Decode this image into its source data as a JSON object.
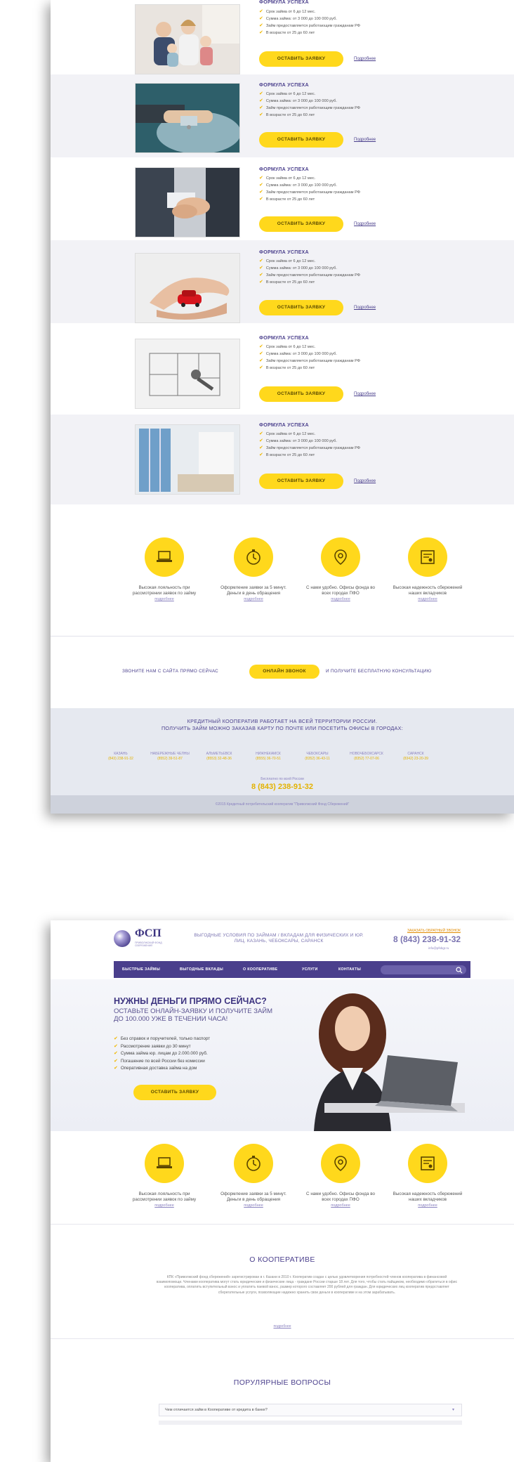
{
  "offers": {
    "title": "ФОРМУЛА УСПЕХА",
    "button": "ОСТАВИТЬ ЗАЯВКУ",
    "more": "Подробнее",
    "items": [
      {
        "image": "family-photo",
        "bullets": [
          "Срок займа от 6 до 12 мес.",
          "Сумма займа: от 3 000 до 100 000 руб.",
          "Займ предоставляется работающим гражданам РФ",
          "В возрасте от 25 до 60 лет"
        ]
      },
      {
        "image": "car-keys-photo",
        "bullets": [
          "Срок займа от 6 до 12 мес.",
          "Сумма займа: от 3 000 до 100 000 руб.",
          "Займ предоставляется работающим гражданам РФ",
          "В возрасте от 25 до 60 лет"
        ]
      },
      {
        "image": "handshake-photo",
        "bullets": [
          "Срок займа от 6 до 12 мес.",
          "Сумма займа: от 3 000 до 100 000 руб.",
          "Займ предоставляется работающим гражданам РФ",
          "В возрасте от 25 до 60 лет"
        ]
      },
      {
        "image": "hands-red-car-photo",
        "bullets": [
          "Срок займа от 6 до 12 мес.",
          "Сумма займа: от 3 000 до 100 000 руб.",
          "Займ предоставляется работающим гражданам РФ",
          "В возрасте от 25 до 60 лет"
        ]
      },
      {
        "image": "floorplan-key-photo",
        "bullets": [
          "Срок займа от 6 до 12 мес.",
          "Сумма займа: от 3 000 до 100 000 руб.",
          "Займ предоставляется работающим гражданам РФ",
          "В возрасте от 25 до 60 лет"
        ]
      },
      {
        "image": "interior-photo",
        "bullets": [
          "Срок займа от 6 до 12 мес.",
          "Сумма займа: от 3 000 до 100 000 руб.",
          "Займ предоставляется работающим гражданам РФ",
          "В возрасте от 25 до 60 лет"
        ]
      }
    ]
  },
  "features": {
    "link": "подробнее",
    "items": [
      {
        "icon": "laptop-icon",
        "text": "Высокая лояльность при рассмотрении заявок по займу"
      },
      {
        "icon": "stopwatch-icon",
        "text": "Оформление заявки за 5 минут. Деньги в день обращения"
      },
      {
        "icon": "map-pin-icon",
        "text": "С нами удобно. Офисы фонда во всех городах ПФО"
      },
      {
        "icon": "certificate-icon",
        "text": "Высокая надежность сбережений наших вкладчиков"
      }
    ]
  },
  "callstrip": {
    "left": "ЗВОНИТЕ НАМ С САЙТА ПРЯМО СЕЙЧАС",
    "button": "ОНЛАЙН ЗВОНОК",
    "right": "И ПОЛУЧИТЕ БЕСПЛАТНУЮ КОНСУЛЬТАЦИЮ"
  },
  "footer": {
    "line1": "КРЕДИТНЫЙ КООПЕРАТИВ РАБОТАЕТ НА ВСЕЙ ТЕРРИТОРИИ РОССИИ.",
    "line2": "ПОЛУЧИТЬ ЗАЙМ МОЖНО ЗАКАЗАВ КАРТУ ПО ПОЧТЕ ИЛИ ПОСЕТИТЬ ОФИСЫ В ГОРОДАХ:",
    "cities": [
      {
        "name": "КАЗАНЬ",
        "phone": "(843) 238-91-32"
      },
      {
        "name": "НАБЕРЕЖНЫЕ ЧЕЛНЫ",
        "phone": "(8552) 39-51-87"
      },
      {
        "name": "АЛЬМЕТЬЕВСК",
        "phone": "(8553) 32-48-36"
      },
      {
        "name": "НИЖНЕКАМСК",
        "phone": "(8555) 36-70-51"
      },
      {
        "name": "ЧЕБОКСАРЫ",
        "phone": "(8352) 36-43-11"
      },
      {
        "name": "НОВОЧЕБОКСАРСК",
        "phone": "(8352) 77-07-06"
      },
      {
        "name": "САРАНСК",
        "phone": "(8342) 23-20-39"
      }
    ],
    "hotline_label": "Бесплатно по всей России",
    "hotline": "8 (843) 238-91-32",
    "copyright": "©2015 Кредитный потребительский кооператив \"Приволжский Фонд Сбережений\""
  },
  "header": {
    "logo_text": "ФСП",
    "logo_sub": "ПРИВОЛЖСКИЙ ФОНД СБЕРЕЖЕНИЙ",
    "tagline": "ВЫГОДНЫЕ УСЛОВИЯ ПО ЗАЙМАМ / ВКЛАДАМ ДЛЯ ФИЗИЧЕСКИХ И ЮР. ЛИЦ. КАЗАНЬ, ЧЕБОКСАРЫ, САРАНСК",
    "callback_link": "ЗАКАЗАТЬ ОБРАТНЫЙ ЗВОНОК",
    "phone": "8 (843) 238-91-32",
    "email": "info@pfsbgr.ru"
  },
  "nav": {
    "items": [
      "БЫСТРЫЕ ЗАЙМЫ",
      "ВЫГОДНЫЕ ВКЛАДЫ",
      "О КООПЕРАТИВЕ",
      "УСЛУГИ",
      "КОНТАКТЫ"
    ],
    "search_placeholder": ""
  },
  "hero": {
    "title": "НУЖНЫ ДЕНЬГИ ПРЯМО СЕЙЧАС?",
    "subtitle": "ОСТАВЬТЕ ОНЛАЙН-ЗАЯВКУ И ПОЛУЧИТЕ ЗАЙМ ДО 100.000 УЖЕ В ТЕЧЕНИИ ЧАСА!",
    "bullets": [
      "Без справок и поручителей, только паспорт",
      "Рассмотрение заявки до 30 минут",
      "Сумма займа юр. лицам до 2.000.000 руб.",
      "Погашение по всей России без комиссии",
      "Оперативная доставка займа на дом"
    ],
    "button": "ОСТАВИТЬ ЗАЯВКУ"
  },
  "about": {
    "title": "О КООПЕРАТИВЕ",
    "body": "КПК «Приволжский фонд сбережений» зарегистрирован в г. Казани в 2010 г. Кооператив создан с целью удовлетворения потребностей членов кооператива в финансовой взаимопомощи. Членами кооператива могут стать юридические и физические лица - граждане России старше 18 лет. Для того, чтобы стать пайщиком, необходимо обратиться в офис кооператива, оплатить вступительный взнос и уплатить паевой взнос, размер которого составляет 200 рублей для граждан. Для юридических лиц кооператив предоставляет сберегательные услуги, позволяющие надежно хранить свои деньги в кооперативе и на этом зарабатывать.",
    "link": "подробнее"
  },
  "faq": {
    "title": "ПОРУЛЯРНЫЕ ВОПРОСЫ",
    "question": "Чем отличается займ в Кооперативе от кредита в банке?"
  }
}
